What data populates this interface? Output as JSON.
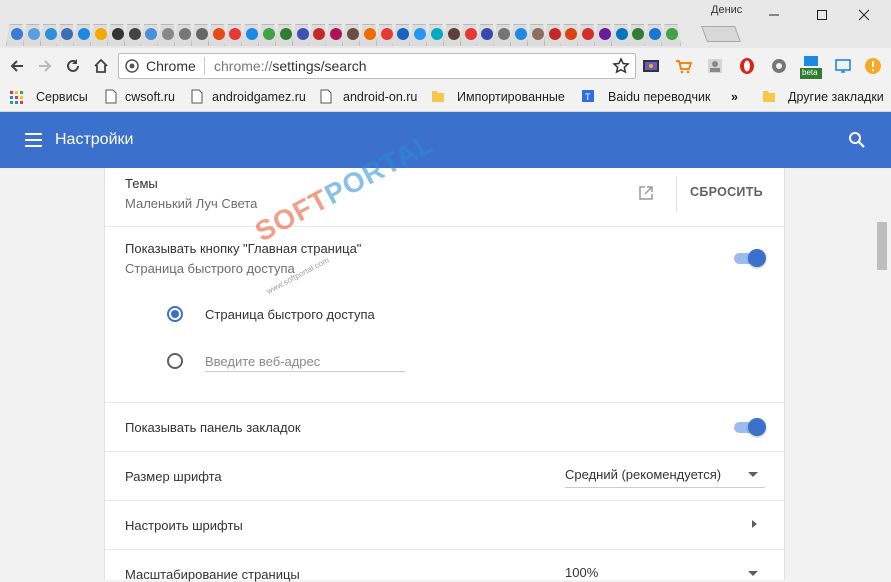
{
  "window": {
    "profile_name": "Денис",
    "tab_favicon_colors": [
      "#3a7bd5",
      "#5aa0e0",
      "#2f8fd8",
      "#3b6fb0",
      "#1e88e5",
      "#f2a900",
      "#333333",
      "#444444",
      "#4a90d9",
      "#888888",
      "#777777",
      "#666666",
      "#e64a19",
      "#e53935",
      "#1e88e5",
      "#43a047",
      "#2e7d32",
      "#3f51b5",
      "#c62828",
      "#ad1457",
      "#6d4c41",
      "#ef6c00",
      "#e53935",
      "#1565c0",
      "#2196f3",
      "#00acc1",
      "#5d4037",
      "#e53935",
      "#3949ab",
      "#757575",
      "#1e88e5",
      "#8d6e63",
      "#c62828",
      "#d84315",
      "#d32f2f",
      "#6a1b9a",
      "#0277bd",
      "#2e7d32",
      "#1976d2",
      "#43a047"
    ],
    "minimize_icon": "minimize-icon",
    "maximize_icon": "maximize-icon",
    "close_icon": "close-icon"
  },
  "toolbar": {
    "back_icon": "back-arrow-icon",
    "forward_icon": "forward-arrow-icon",
    "reload_icon": "reload-icon",
    "home_icon": "home-icon",
    "omnibox_label": "Chrome",
    "url_scheme": "chrome://",
    "url_rest": "settings/search",
    "bookmark_star_icon": "star-icon",
    "extension_badge": "beta",
    "extensions": [
      "video-ext-icon",
      "cart-icon",
      "user-card-icon",
      "opera-icon",
      "gear-icon",
      "beta-ext-icon",
      "cast-icon",
      "warning-icon"
    ]
  },
  "bookmarks": {
    "apps_label": "Сервисы",
    "items": [
      "cwsoft.ru",
      "androidgamez.ru",
      "android-on.ru",
      "Импортированные",
      "Baidu переводчик"
    ],
    "overflow_label": "»",
    "other_label": "Другие закладки"
  },
  "settings": {
    "title": "Настройки",
    "themes_label": "Темы",
    "themes_value": "Маленький Луч Света",
    "reset_label": "СБРОСИТЬ",
    "home_button_label": "Показывать кнопку \"Главная страница\"",
    "home_button_sub": "Страница быстрого доступа",
    "home_button_enabled": true,
    "radio_ntp_label": "Страница быстрого доступа",
    "radio_url_placeholder": "Введите веб-адрес",
    "bookmarks_bar_label": "Показывать панель закладок",
    "bookmarks_bar_enabled": true,
    "font_size_label": "Размер шрифта",
    "font_size_value": "Средний (рекомендуется)",
    "customize_fonts_label": "Настроить шрифты",
    "zoom_label": "Масштабирование страницы",
    "zoom_value": "100%"
  },
  "watermark": {
    "soft": "SOFT",
    "portal": "PORTAL",
    "sub": "www.softportal.com"
  },
  "colors": {
    "header_blue": "#3b70cc",
    "toggle_track": "#9cbcef"
  }
}
